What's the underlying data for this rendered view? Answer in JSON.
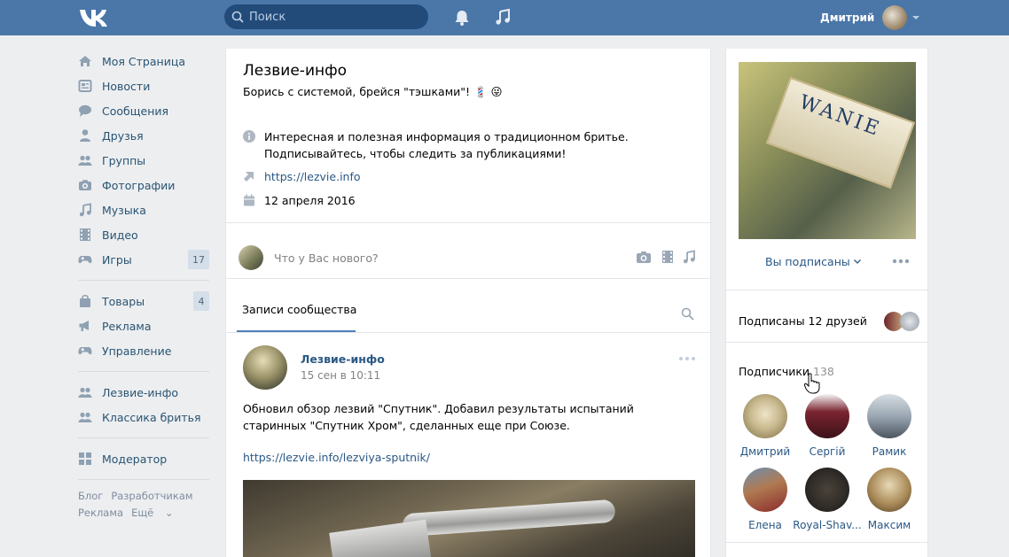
{
  "topbar": {
    "search_placeholder": "Поиск",
    "user_name": "Дмитрий",
    "icons": [
      "vk-logo-icon",
      "search-icon",
      "bell-icon",
      "music-note-icon",
      "chevron-down-icon"
    ]
  },
  "sidebar": {
    "items": [
      {
        "label": "Моя Страница",
        "icon": "home-icon"
      },
      {
        "label": "Новости",
        "icon": "news-icon"
      },
      {
        "label": "Сообщения",
        "icon": "chat-bubble-icon"
      },
      {
        "label": "Друзья",
        "icon": "user-icon"
      },
      {
        "label": "Группы",
        "icon": "group-icon"
      },
      {
        "label": "Фотографии",
        "icon": "camera-icon"
      },
      {
        "label": "Музыка",
        "icon": "music-note-icon"
      },
      {
        "label": "Видео",
        "icon": "film-icon"
      },
      {
        "label": "Игры",
        "icon": "gamepad-icon",
        "badge": "17"
      }
    ],
    "items2": [
      {
        "label": "Товары",
        "icon": "shopping-bag-icon",
        "badge": "4"
      },
      {
        "label": "Реклама",
        "icon": "megaphone-icon"
      },
      {
        "label": "Управление",
        "icon": "gamepad-icon"
      }
    ],
    "items3": [
      {
        "label": "Лезвие-инфо",
        "icon": "group-icon"
      },
      {
        "label": "Классика бритья",
        "icon": "group-icon"
      }
    ],
    "items4": [
      {
        "label": "Модератор",
        "icon": "grid-icon"
      }
    ],
    "footer": {
      "blog": "Блог",
      "dev": "Разработчикам",
      "ads": "Реклама",
      "more": "Ещё"
    }
  },
  "community": {
    "title": "Лезвие-инфо",
    "status": "Борись с системой, брейся \"тэшками\"! 💈 😜",
    "info_line1": "Интересная и полезная информация о традиционном бритье.",
    "info_line2": "Подписывайтесь, чтобы следить за публикациями!",
    "website": "https://lezvie.info",
    "date": "12 апреля 2016"
  },
  "composer": {
    "placeholder": "Что у Вас нового?",
    "icons": [
      "camera-icon",
      "film-icon",
      "music-note-icon"
    ]
  },
  "wall": {
    "tab_label": "Записи сообщества"
  },
  "post": {
    "author": "Лезвие-инфо",
    "time": "15 сен в 10:11",
    "text": "Обновил обзор лезвий \"Спутник\". Добавил результаты испытаний старинных \"Спутник Хром\", сделанных еще при Союзе.",
    "link": "https://lezvie.info/lezviya-sputnik/"
  },
  "right": {
    "cover_word": "WANIE",
    "subscribed_label": "Вы подписаны",
    "friends_label": "Подписаны 12 друзей",
    "subscribers_label": "Подписчики",
    "subscribers_count": "138",
    "members": [
      {
        "name": "Дмитрий",
        "color": "#c9b98f"
      },
      {
        "name": "Сергій",
        "color": "#7a2430"
      },
      {
        "name": "Рамик",
        "color": "#9aa7b3"
      },
      {
        "name": "Елена",
        "color": "#b07a52"
      },
      {
        "name": "Royal-Shav...",
        "color": "#2e2a26"
      },
      {
        "name": "Максим",
        "color": "#a98a58"
      }
    ]
  },
  "colors": {
    "header": "#4a76a8",
    "link": "#2a5885",
    "page_bg": "#edeef0",
    "accent": "#5181b8"
  }
}
